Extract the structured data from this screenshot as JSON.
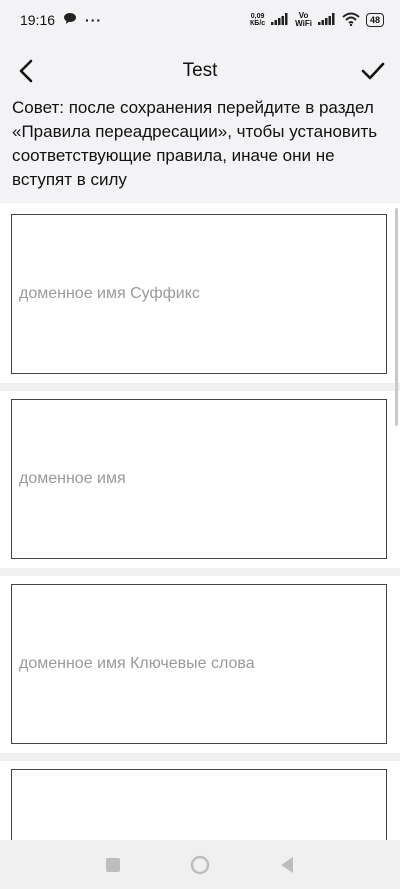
{
  "status_bar": {
    "time": "19:16",
    "more": "···",
    "net_speed_value": "0,09",
    "net_speed_unit": "КБ/с",
    "vo": "Vo",
    "wifi_label": "WiFi",
    "battery": "48"
  },
  "header": {
    "title": "Test",
    "back_icon": "chevron-left-icon",
    "confirm_icon": "check-icon"
  },
  "tip": {
    "text": "Совет: после сохранения перейдите в раздел «Правила переадресации», чтобы установить соответствующие правила, иначе они не вступят в силу"
  },
  "fields": [
    {
      "placeholder": "доменное имя Суффикс",
      "value": ""
    },
    {
      "placeholder": "доменное имя",
      "value": ""
    },
    {
      "placeholder": "доменное имя Ключевые слова",
      "value": ""
    },
    {
      "placeholder": "",
      "value": ""
    }
  ],
  "nav_bar": {
    "recents_icon": "square-icon",
    "home_icon": "circle-icon",
    "back_icon": "triangle-back-icon"
  }
}
